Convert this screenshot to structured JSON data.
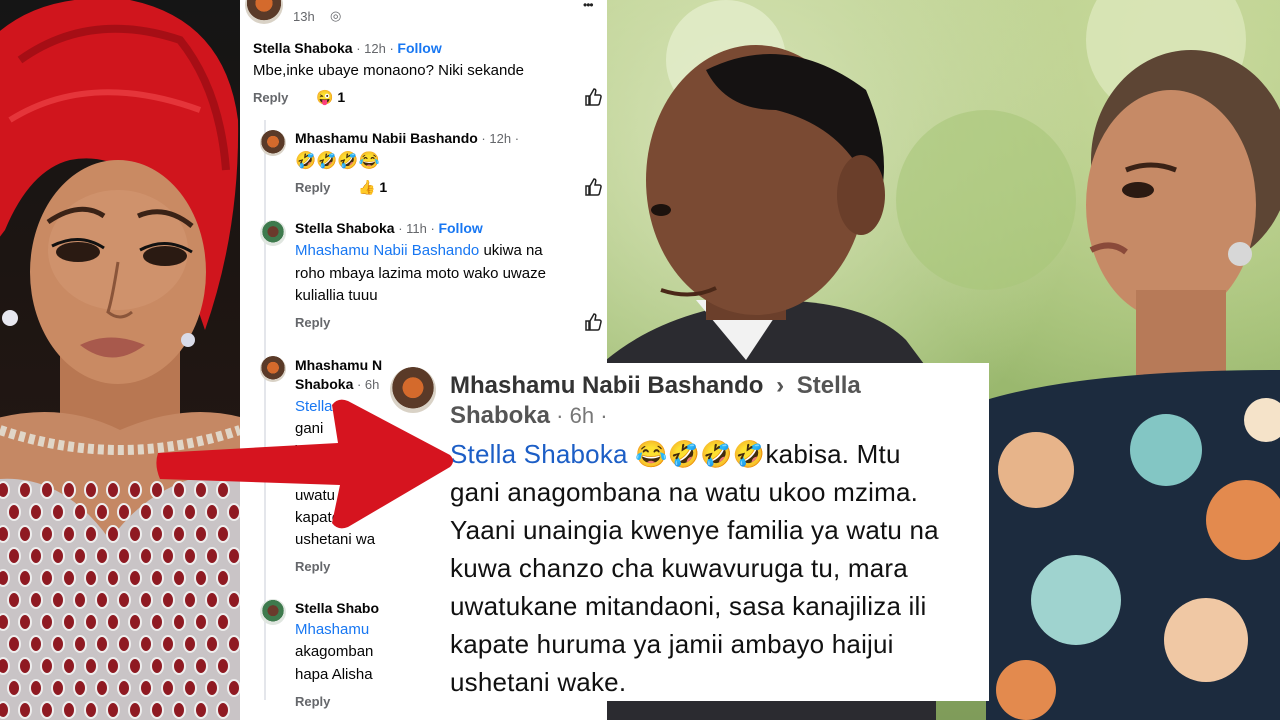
{
  "top_comment": {
    "time": "13h",
    "more": "•••"
  },
  "comments": [
    {
      "name": "Stella Shaboka",
      "time": "12h",
      "follow": "Follow",
      "lines": [
        "Mbe,inke ubaye monaono? Niki sekande"
      ],
      "reply": "Reply",
      "reaction_emoji": "😜",
      "reaction_count": "1"
    },
    {
      "name": "Mhashamu Nabii Bashando",
      "time": "12h",
      "lines": [
        "🤣🤣🤣😂"
      ],
      "reply": "Reply",
      "reaction_emoji": "👍",
      "reaction_count": "1"
    },
    {
      "name": "Stella Shaboka",
      "time": "11h",
      "follow": "Follow",
      "mention": "Mhashamu Nabii Bashando",
      "lines": [
        " ukiwa na",
        "roho mbaya lazima moto wako uwaze",
        "kuliallia tuuu"
      ],
      "reply": "Reply"
    },
    {
      "name": "Mhashamu N",
      "time": "6h",
      "name_line2": "Shaboka",
      "lines": [
        "Stella",
        "gani",
        "Yaani",
        "kuwa",
        "uwatu",
        "kapate",
        "ushetani wa"
      ],
      "reply": "Reply"
    },
    {
      "name": "Stella Shabo",
      "mention": "Mhashamu",
      "lines": [
        "akagomban",
        "hapa Alisha"
      ],
      "reply": "Reply"
    }
  ],
  "overlay": {
    "author": "Mhashamu Nabii Bashando",
    "chevron": "›",
    "recipient_first": "Stella",
    "recipient_rest": "Shaboka",
    "time": "6h",
    "mention": "Stella Shaboka",
    "emojis": "😂🤣🤣🤣",
    "lines": [
      "kabisa. Mtu",
      "gani anagombana na watu ukoo mzima.",
      "Yaani unaingia kwenye familia ya watu na",
      "kuwa chanzo cha kuwavuruga tu, mara",
      "uwatukane mitandaoni, sasa kanajiliza ili",
      "kapate huruma ya jamii ambayo haijui",
      "ushetani wake."
    ]
  },
  "colors": {
    "link_blue": "#1877f2",
    "meta_gray": "#65676b",
    "arrow_red": "#d6141f"
  }
}
